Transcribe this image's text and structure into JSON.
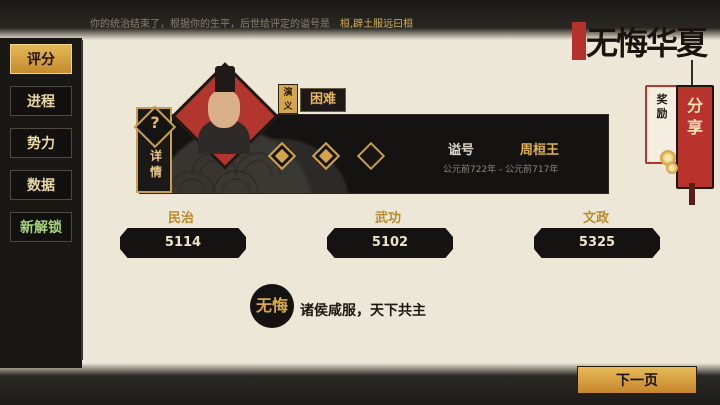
{
  "header": {
    "summary_text": "你的统治结束了，根据你的生平，后世给评定的谥号是",
    "highlight": "桓,辟土服远曰桓"
  },
  "sidebar": {
    "items": [
      {
        "label": "评分",
        "active": true
      },
      {
        "label": "进程"
      },
      {
        "label": "势力"
      },
      {
        "label": "数据"
      },
      {
        "label": "新解锁"
      }
    ]
  },
  "logo": {
    "text": "无悔华夏"
  },
  "share": {
    "label": "分享",
    "reward_label": "奖励"
  },
  "detail": {
    "symbol": "?",
    "label": "详情"
  },
  "difficulty": {
    "mode": "演义",
    "level": "困难"
  },
  "achievements": {
    "filled": 2,
    "total": 3
  },
  "posthumous": {
    "label": "谥号",
    "name": "周桓王",
    "years": "公元前722年 - 公元前717年"
  },
  "stats": [
    {
      "label": "民治",
      "value": "5114"
    },
    {
      "label": "武功",
      "value": "5102"
    },
    {
      "label": "文政",
      "value": "5325"
    }
  ],
  "motto": {
    "seal": "无悔",
    "text": "诸侯咸服，天下共主"
  },
  "next_button": {
    "label": "下一页"
  },
  "colors": {
    "gold": "#d4a34a",
    "red": "#b8332b",
    "dark": "#141312",
    "paper": "#ece7d6"
  }
}
